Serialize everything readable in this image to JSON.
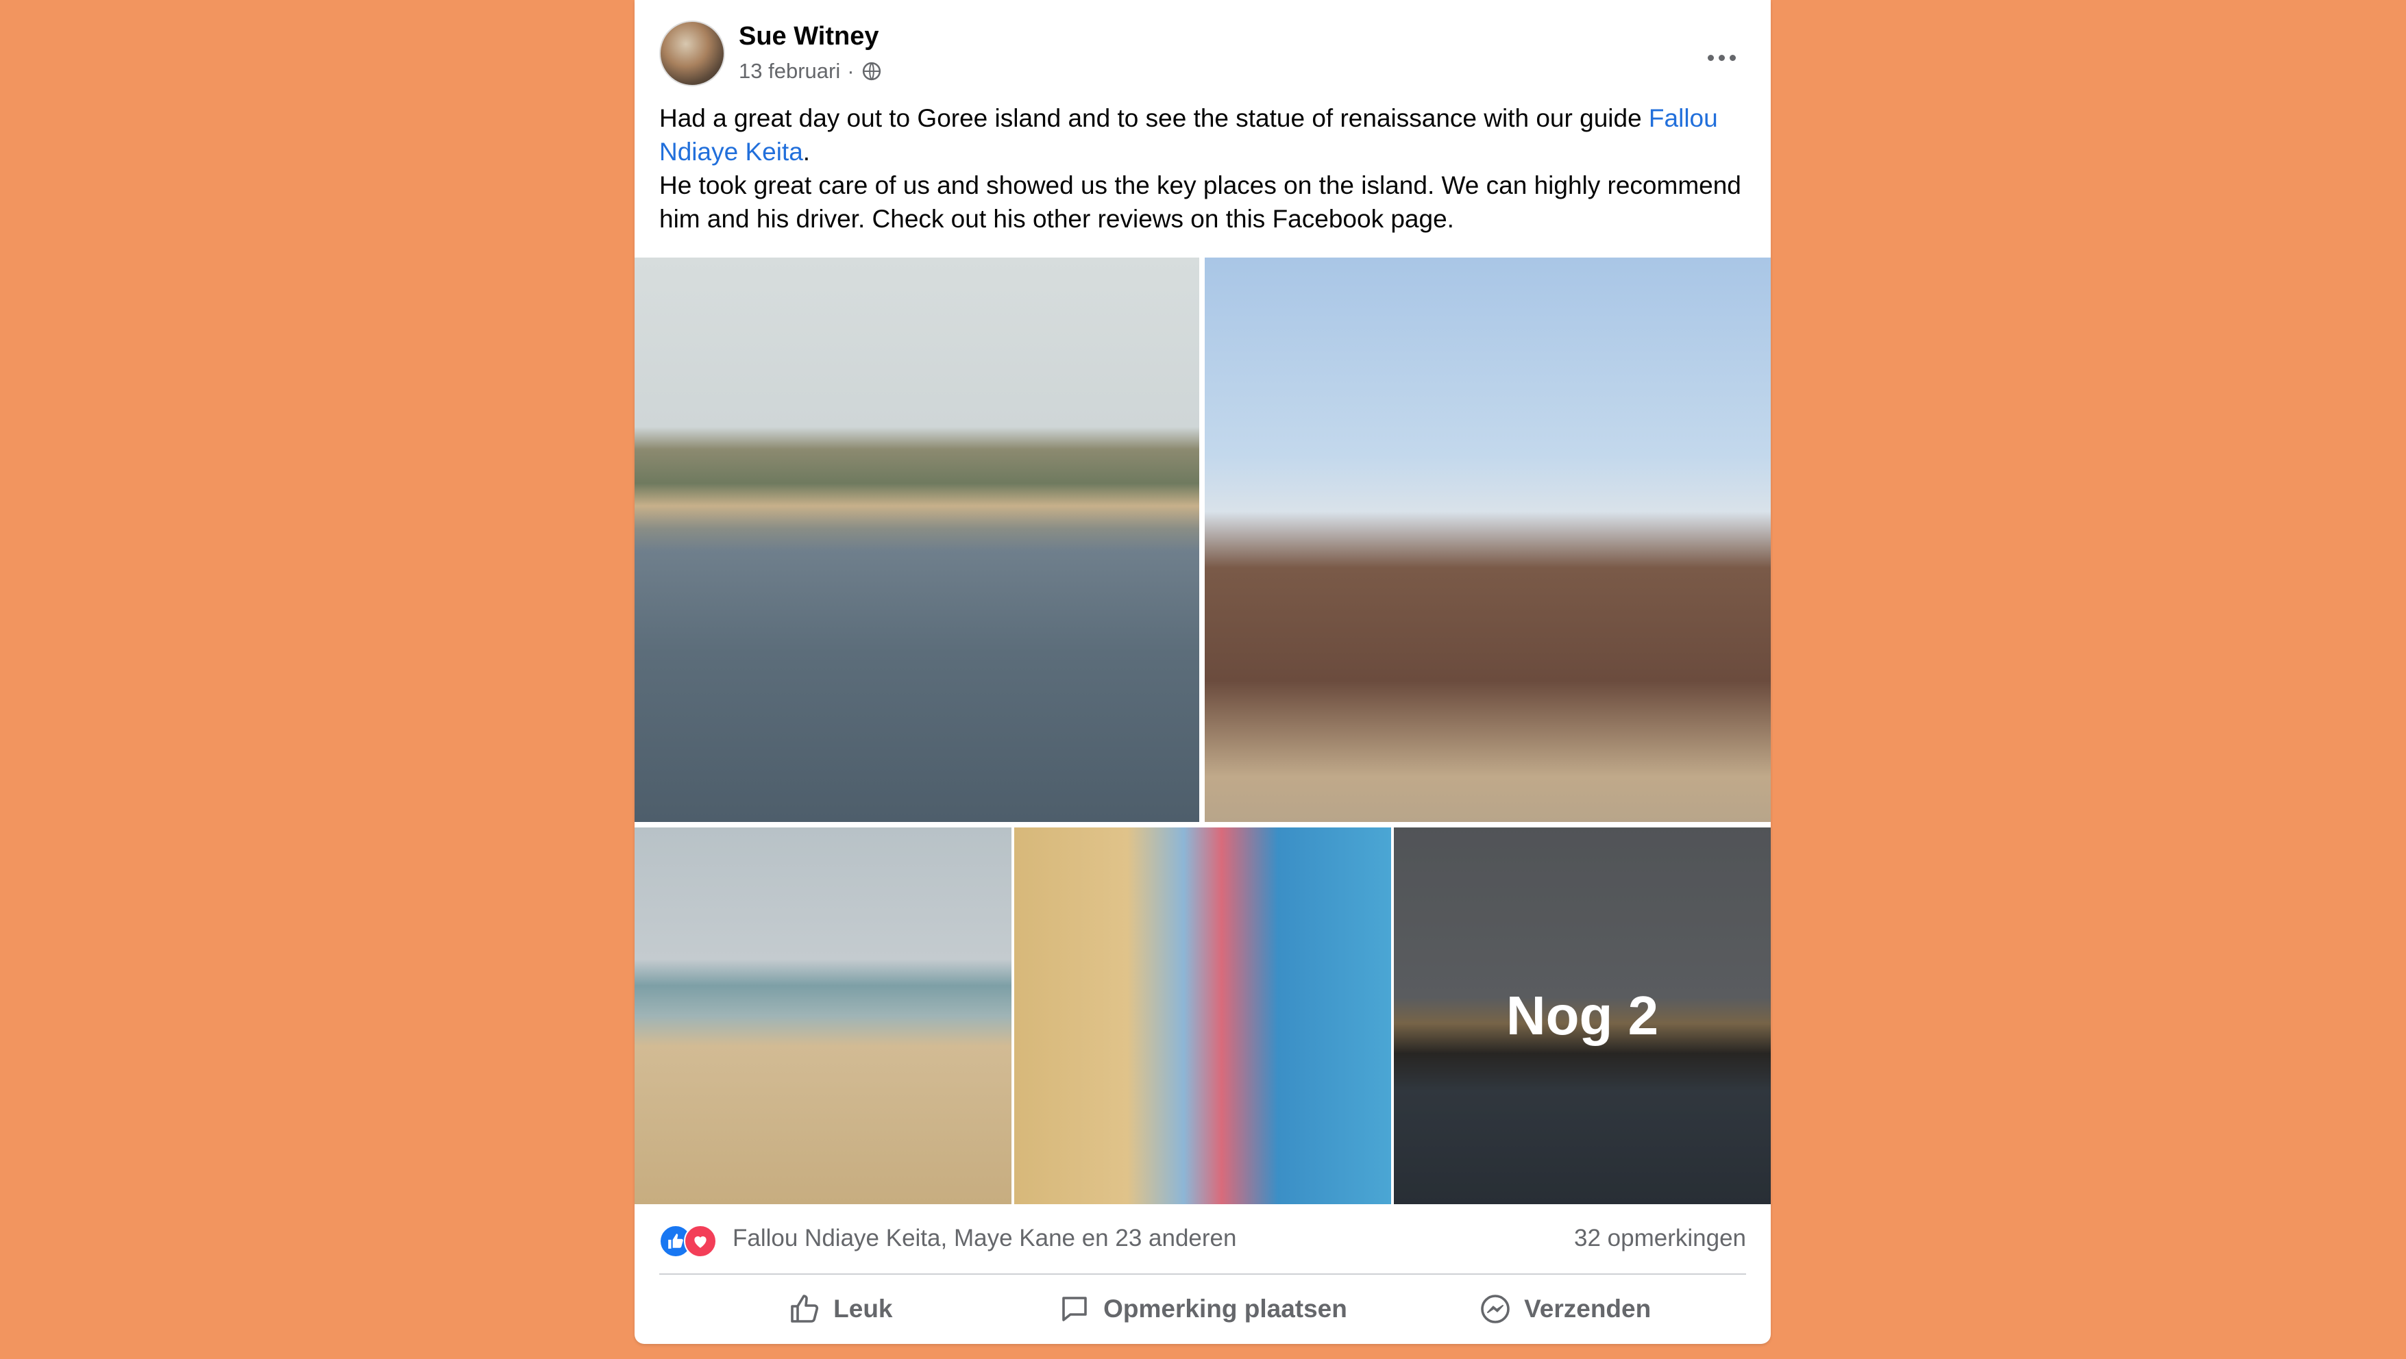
{
  "post": {
    "author": "Sue Witney",
    "date": "13 februari",
    "date_separator": "·",
    "privacy_icon": "globe-icon",
    "text_part1": "Had a great day out to Goree island and to see the statue of renaissance with our guide ",
    "mention": "Fallou Ndiaye Keita",
    "text_part2": ".",
    "text_paragraph2": "He took great care of us and showed us the key places on the island. We can highly recommend him and his driver. Check out his other reviews on this Facebook page."
  },
  "photos": {
    "more_label": "Nog 2"
  },
  "reactions": {
    "names": "Fallou Ndiaye Keita, Maye Kane en 23 anderen",
    "comments": "32 opmerkingen"
  },
  "actions": {
    "like": "Leuk",
    "comment": "Opmerking plaatsen",
    "send": "Verzenden"
  },
  "colors": {
    "background": "#f2955f",
    "mention": "#216fdb",
    "like": "#1877f2",
    "love": "#f33e58"
  }
}
